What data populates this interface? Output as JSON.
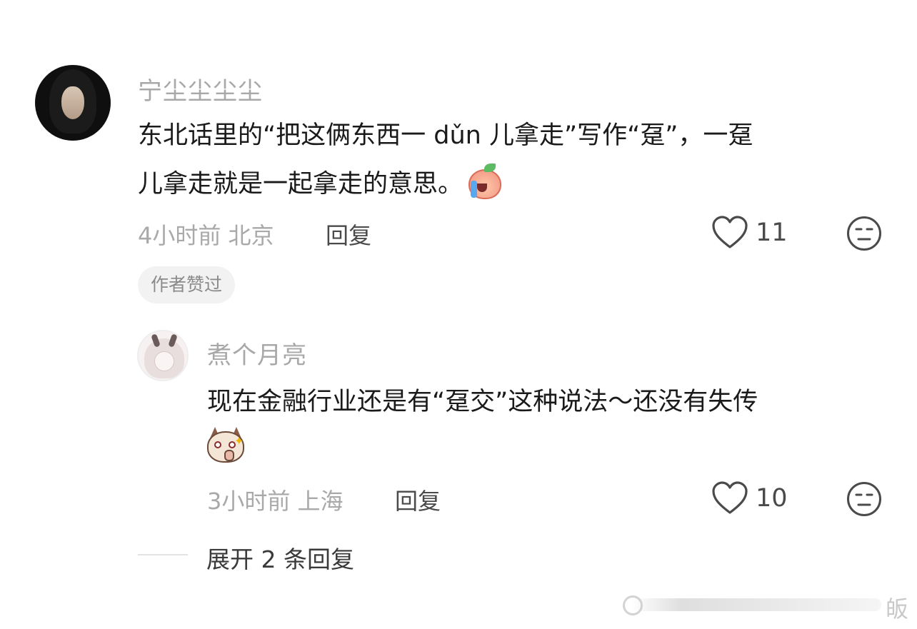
{
  "comment": {
    "username": "宁尘尘尘尘",
    "content_line1": "东北话里的“把这俩东西一 dǔn 儿拿走”写作“趸”，一趸",
    "content_line2": "儿拿走就是一起拿走的意思。",
    "emoji": "crying-peach-emoji",
    "time_location": "4小时前 北京",
    "reply_label": "回复",
    "like_count": "11",
    "author_badge": "作者赞过"
  },
  "reply": {
    "username": "煮个月亮",
    "content_line1": "现在金融行业还是有“趸交”这种说法～还没有失传",
    "emoji": "cat-finger-heart-emoji",
    "time_location": "3小时前 上海",
    "reply_label": "回复",
    "like_count": "10"
  },
  "expand": {
    "label": "展开 2 条回复"
  },
  "watermark": {
    "char": "皈"
  },
  "colors": {
    "username": "#a8a8a8",
    "text": "#1a1a1a",
    "meta": "#a9a9a9",
    "badge_bg": "#f2f2f2"
  }
}
